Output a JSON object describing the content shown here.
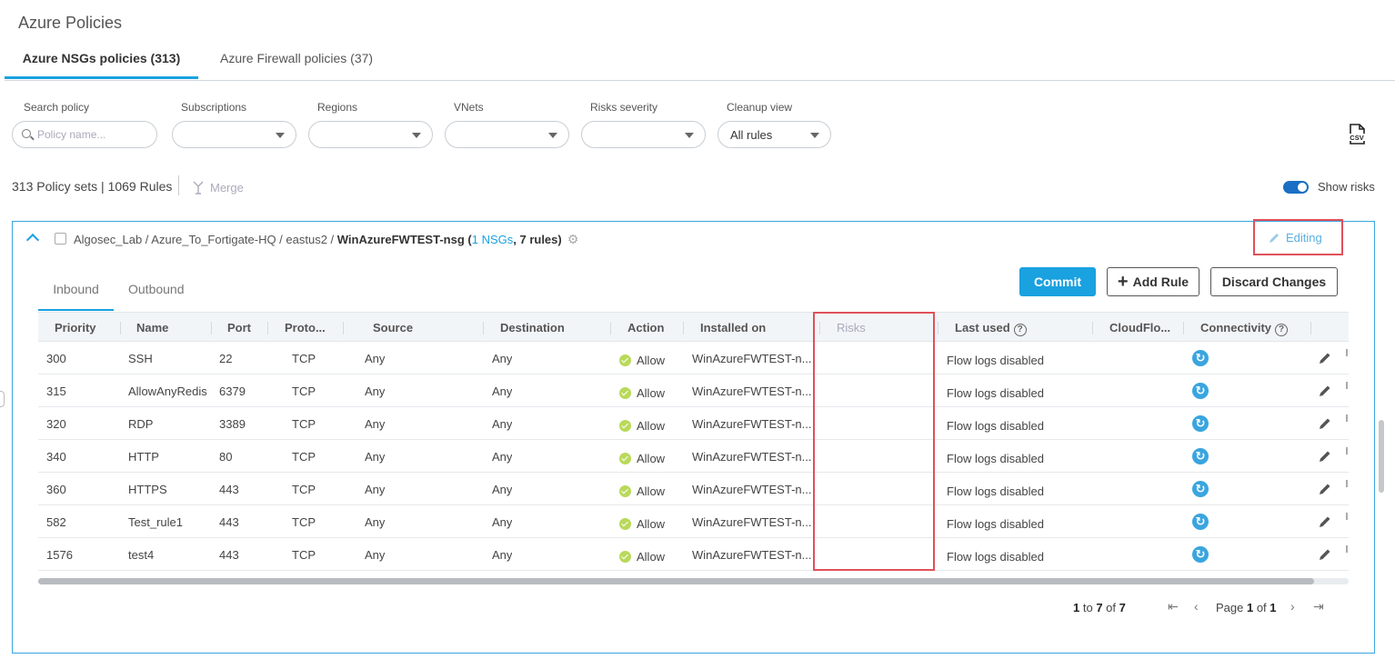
{
  "page": {
    "title": "Azure Policies"
  },
  "tabs": [
    {
      "label": "Azure NSGs policies (313)",
      "active": true
    },
    {
      "label": "Azure Firewall policies (37)",
      "active": false
    }
  ],
  "filters": {
    "search": {
      "label": "Search policy",
      "placeholder": "Policy name..."
    },
    "subscriptions": {
      "label": "Subscriptions",
      "value": ""
    },
    "regions": {
      "label": "Regions",
      "value": ""
    },
    "vnets": {
      "label": "VNets",
      "value": ""
    },
    "risks_severity": {
      "label": "Risks severity",
      "value": ""
    },
    "cleanup_view": {
      "label": "Cleanup view",
      "value": "All rules"
    }
  },
  "icons": {
    "csv": "csv-export-icon",
    "merge": "merge-icon",
    "gear": "gear-icon",
    "pencil": "pencil-icon",
    "connectivity": "connectivity-refresh-icon",
    "allow": "check-circle-icon"
  },
  "summary": {
    "counts": "313 Policy sets | 1069 Rules",
    "merge_label": "Merge",
    "show_risks_label": "Show risks",
    "show_risks_on": true
  },
  "policy_set": {
    "path_prefix": "Algosec_Lab / Azure_To_Fortigate-HQ / eastus2 / ",
    "name": "WinAzureFWTEST-nsg",
    "paren_open": " (",
    "nsg_count": "1 NSGs",
    "rules_count": ", 7 rules)",
    "editing_label": "Editing"
  },
  "actions": {
    "commit": "Commit",
    "add_rule": "Add Rule",
    "discard": "Discard Changes"
  },
  "direction_tabs": [
    {
      "label": "Inbound",
      "active": true
    },
    {
      "label": "Outbound",
      "active": false
    }
  ],
  "columns": {
    "priority": "Priority",
    "name": "Name",
    "port": "Port",
    "protocol": "Proto...",
    "source": "Source",
    "destination": "Destination",
    "action": "Action",
    "installed_on": "Installed on",
    "risks": "Risks",
    "last_used": "Last used",
    "cloudflow": "CloudFlo...",
    "connectivity": "Connectivity"
  },
  "rows": [
    {
      "priority": "300",
      "name": "SSH",
      "port": "22",
      "protocol": "TCP",
      "source": "Any",
      "destination": "Any",
      "action": "Allow",
      "installed_on": "WinAzureFWTEST-n...",
      "risks": "",
      "last_used": "Flow logs disabled"
    },
    {
      "priority": "315",
      "name": "AllowAnyRedisI",
      "port": "6379",
      "protocol": "TCP",
      "source": "Any",
      "destination": "Any",
      "action": "Allow",
      "installed_on": "WinAzureFWTEST-n...",
      "risks": "",
      "last_used": "Flow logs disabled"
    },
    {
      "priority": "320",
      "name": "RDP",
      "port": "3389",
      "protocol": "TCP",
      "source": "Any",
      "destination": "Any",
      "action": "Allow",
      "installed_on": "WinAzureFWTEST-n...",
      "risks": "",
      "last_used": "Flow logs disabled"
    },
    {
      "priority": "340",
      "name": "HTTP",
      "port": "80",
      "protocol": "TCP",
      "source": "Any",
      "destination": "Any",
      "action": "Allow",
      "installed_on": "WinAzureFWTEST-n...",
      "risks": "",
      "last_used": "Flow logs disabled"
    },
    {
      "priority": "360",
      "name": "HTTPS",
      "port": "443",
      "protocol": "TCP",
      "source": "Any",
      "destination": "Any",
      "action": "Allow",
      "installed_on": "WinAzureFWTEST-n...",
      "risks": "",
      "last_used": "Flow logs disabled"
    },
    {
      "priority": "582",
      "name": "Test_rule1",
      "port": "443",
      "protocol": "TCP",
      "source": "Any",
      "destination": "Any",
      "action": "Allow",
      "installed_on": "WinAzureFWTEST-n...",
      "risks": "",
      "last_used": "Flow logs disabled"
    },
    {
      "priority": "1576",
      "name": "test4",
      "port": "443",
      "protocol": "TCP",
      "source": "Any",
      "destination": "Any",
      "action": "Allow",
      "installed_on": "WinAzureFWTEST-n...",
      "risks": "",
      "last_used": "Flow logs disabled"
    }
  ],
  "pager": {
    "from": "1",
    "to_word": " to ",
    "to": "7",
    "of_word": " of ",
    "total": "7",
    "page_word": "Page ",
    "page": "1",
    "pages": "1"
  },
  "colors": {
    "accent": "#1aa1e0",
    "highlight": "#e0505a",
    "allow": "#b9d95a",
    "toggle": "#1a6fc4"
  }
}
